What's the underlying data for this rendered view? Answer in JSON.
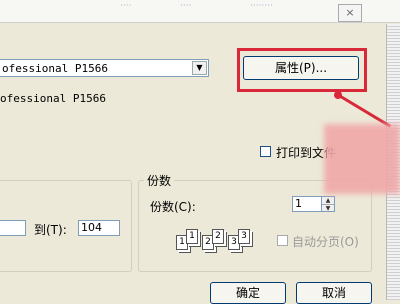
{
  "window": {
    "close_glyph": "×"
  },
  "printer": {
    "name_selected": "ofessional P1566",
    "name_display": "ofessional P1566",
    "properties_button": "属性(P)..."
  },
  "options": {
    "print_to_file_label": "打印到文件"
  },
  "page_range": {
    "to_label": "到(T):",
    "to_value": "104"
  },
  "copies": {
    "group_title": "份数",
    "label": "份数(C):",
    "value": "1",
    "collate_label": "自动分页(O)",
    "collate_pages": [
      "1",
      "1",
      "2",
      "2",
      "3",
      "3"
    ]
  },
  "buttons": {
    "ok": "确定",
    "cancel": "取消"
  },
  "annotation": {
    "highlight_color": "#d8283a"
  }
}
